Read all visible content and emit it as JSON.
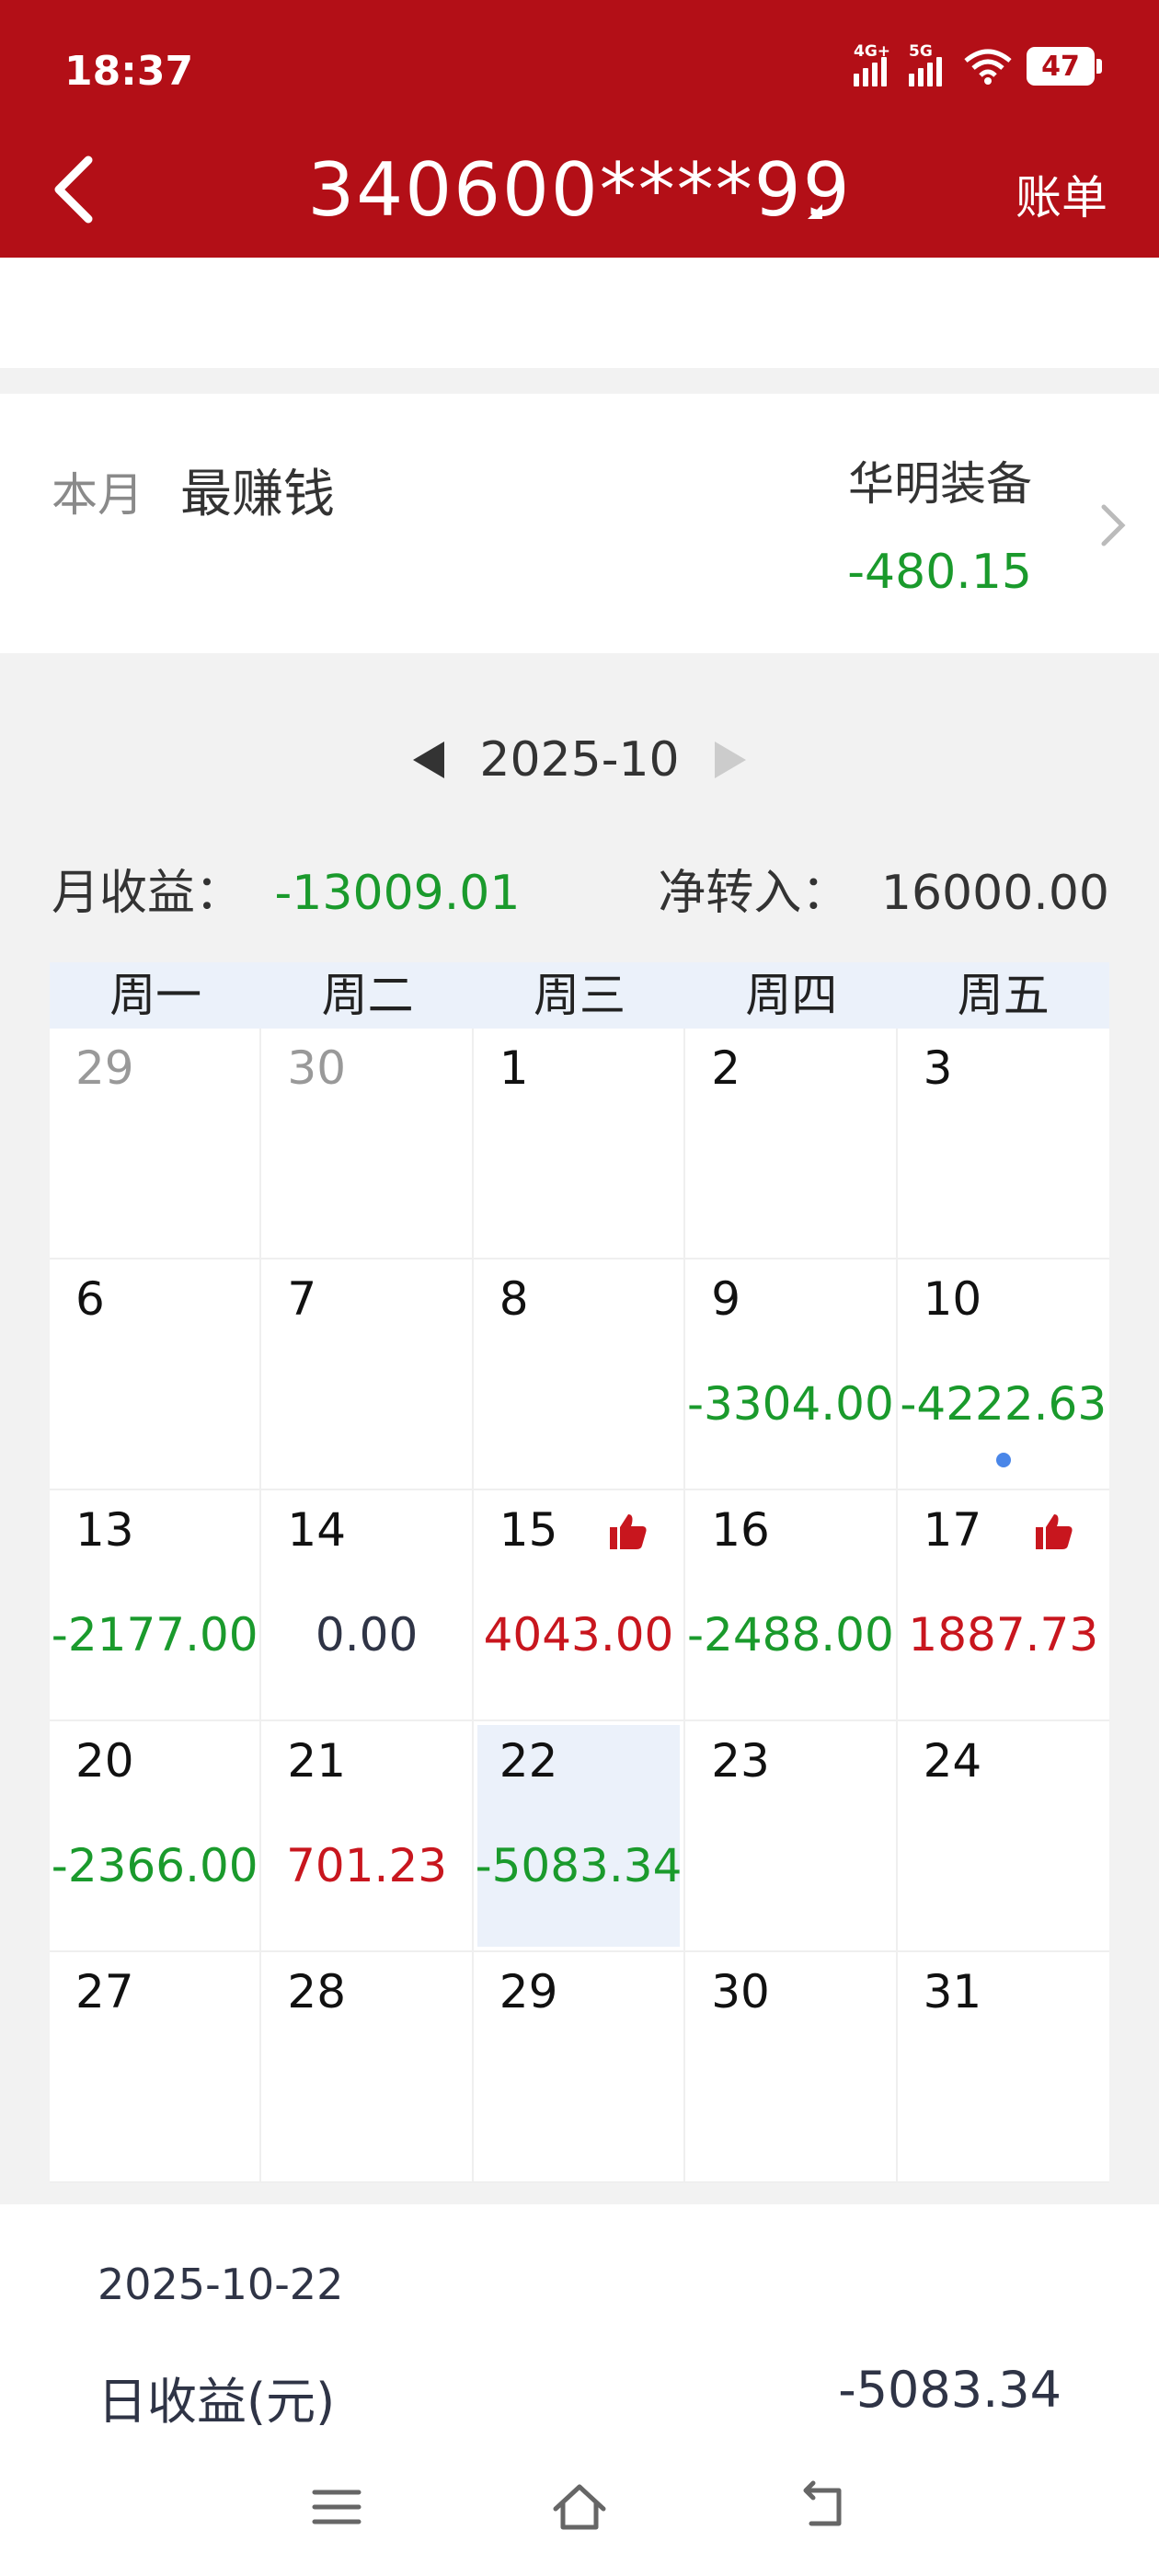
{
  "status": {
    "time": "18:37",
    "net1": "4G+",
    "net2": "5G",
    "battery": "47"
  },
  "header": {
    "title": "340600****99",
    "right_label": "账单"
  },
  "best": {
    "label_month": "本月",
    "label_best": "最赚钱",
    "stock_name": "华明装备",
    "stock_value": "-480.15"
  },
  "month_nav": {
    "month": "2025-10"
  },
  "summary": {
    "income_label": "月收益：",
    "income_value": "-13009.01",
    "transfer_label": "净转入：",
    "transfer_value": "16000.00"
  },
  "calendar": {
    "weekdays": [
      "周一",
      "周二",
      "周三",
      "周四",
      "周五"
    ],
    "cells": [
      {
        "day": "29",
        "other": true,
        "amount": "",
        "kind": ""
      },
      {
        "day": "30",
        "other": true,
        "amount": "",
        "kind": ""
      },
      {
        "day": "1",
        "amount": "",
        "kind": ""
      },
      {
        "day": "2",
        "amount": "",
        "kind": ""
      },
      {
        "day": "3",
        "amount": "",
        "kind": ""
      },
      {
        "day": "6",
        "amount": "",
        "kind": ""
      },
      {
        "day": "7",
        "amount": "",
        "kind": ""
      },
      {
        "day": "8",
        "amount": "",
        "kind": ""
      },
      {
        "day": "9",
        "amount": "-3304.00",
        "kind": "neg"
      },
      {
        "day": "10",
        "amount": "-4222.63",
        "kind": "neg",
        "dot": true
      },
      {
        "day": "13",
        "amount": "-2177.00",
        "kind": "neg"
      },
      {
        "day": "14",
        "amount": "0.00",
        "kind": "zero"
      },
      {
        "day": "15",
        "amount": "4043.00",
        "kind": "pos",
        "thumb": true
      },
      {
        "day": "16",
        "amount": "-2488.00",
        "kind": "neg"
      },
      {
        "day": "17",
        "amount": "1887.73",
        "kind": "pos",
        "thumb": true
      },
      {
        "day": "20",
        "amount": "-2366.00",
        "kind": "neg"
      },
      {
        "day": "21",
        "amount": "701.23",
        "kind": "pos"
      },
      {
        "day": "22",
        "amount": "-5083.34",
        "kind": "neg",
        "selected": true
      },
      {
        "day": "23",
        "amount": "",
        "kind": ""
      },
      {
        "day": "24",
        "amount": "",
        "kind": ""
      },
      {
        "day": "27",
        "amount": "",
        "kind": ""
      },
      {
        "day": "28",
        "amount": "",
        "kind": ""
      },
      {
        "day": "29",
        "amount": "",
        "kind": ""
      },
      {
        "day": "30",
        "amount": "",
        "kind": ""
      },
      {
        "day": "31",
        "amount": "",
        "kind": ""
      }
    ]
  },
  "detail": {
    "date": "2025-10-22",
    "label": "日收益(元)",
    "value": "-5083.34"
  },
  "colors": {
    "header": "#b30f17",
    "negative": "#1a9a2c",
    "positive": "#c8161e",
    "selected_bg": "#ebf1fa"
  }
}
